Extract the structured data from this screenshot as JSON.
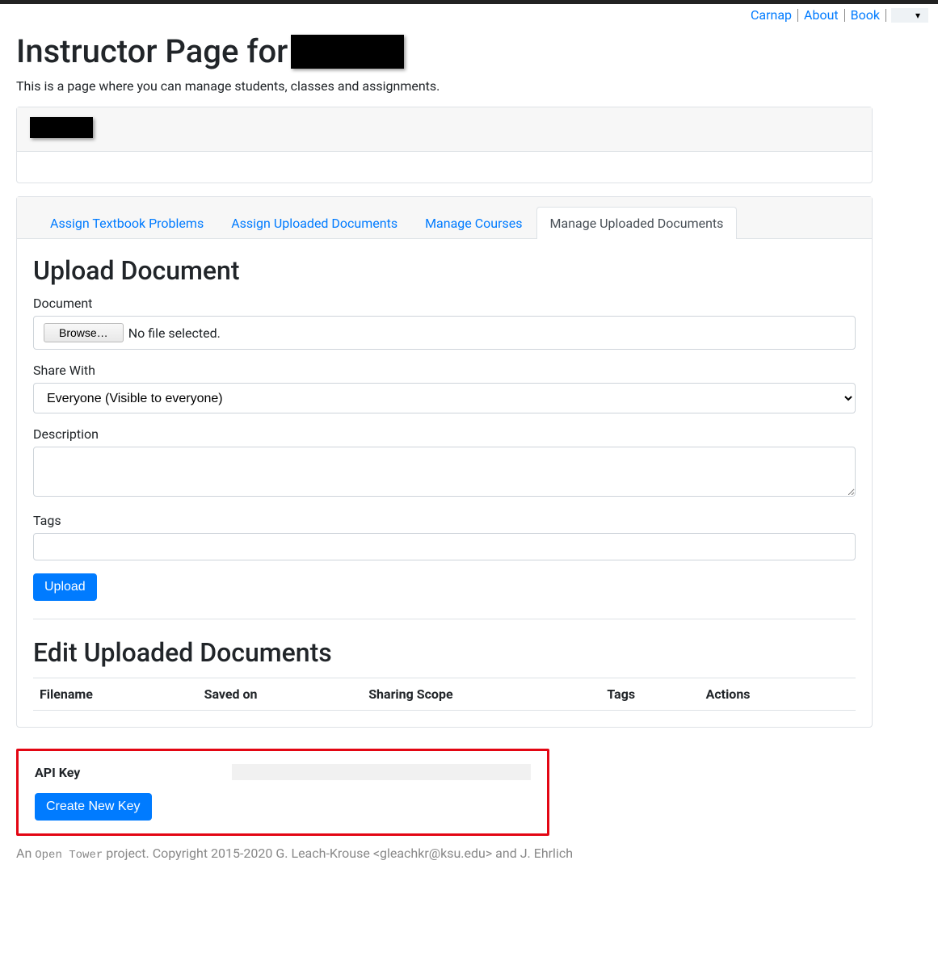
{
  "nav": {
    "links": [
      "Carnap",
      "About",
      "Book"
    ],
    "dropdown_glyph": "▾"
  },
  "page": {
    "title_prefix": "Instructor Page for",
    "subtitle": "This is a page where you can manage students, classes and assignments."
  },
  "tabs": {
    "items": [
      {
        "label": "Assign Textbook Problems",
        "active": false
      },
      {
        "label": "Assign Uploaded Documents",
        "active": false
      },
      {
        "label": "Manage Courses",
        "active": false
      },
      {
        "label": "Manage Uploaded Documents",
        "active": true
      }
    ]
  },
  "upload": {
    "heading": "Upload Document",
    "document_label": "Document",
    "browse_label": "Browse…",
    "file_status": "No file selected.",
    "share_label": "Share With",
    "share_value": "Everyone (Visible to everyone)",
    "description_label": "Description",
    "description_value": "",
    "tags_label": "Tags",
    "tags_value": "",
    "submit_label": "Upload"
  },
  "edit": {
    "heading": "Edit Uploaded Documents",
    "columns": [
      "Filename",
      "Saved on",
      "Sharing Scope",
      "Tags",
      "Actions"
    ]
  },
  "api": {
    "label": "API Key",
    "create_label": "Create New Key"
  },
  "footer": {
    "prefix": "An ",
    "project": "Open Tower",
    "rest": " project. Copyright 2015-2020 G. Leach-Krouse <gleachkr@ksu.edu> and J. Ehrlich"
  }
}
